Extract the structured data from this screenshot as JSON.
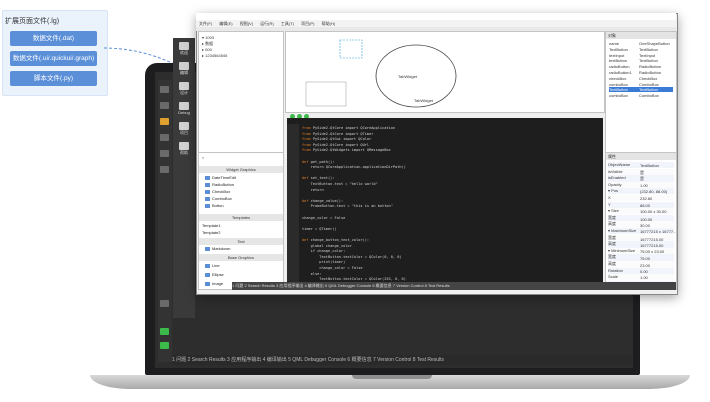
{
  "info_panel": {
    "title": "扩展页面文件(.lg)",
    "chips": [
      "数据文件(.dat)",
      "数据文件(.ui/.quickui/.graph)",
      "脚本文件(.py)"
    ]
  },
  "colors": {
    "accent": "#5b8fd8",
    "panel_bg": "#eaf2fc",
    "editor_bg": "#1e1e1e",
    "keyword": "#e67e22"
  },
  "app": {
    "menu": [
      "文件(F)",
      "编辑(E)",
      "视图(V)",
      "运行(R)",
      "工具(T)",
      "项目(P)",
      "帮助(H)"
    ],
    "left_tree": [
      "▾ 1003",
      "  ▸ 数据",
      "  ▸ 000",
      "  ▸ 1234564545"
    ],
    "canvas": {
      "ellipse_label": "TabWidget",
      "label_bottom": "TabWidget"
    },
    "widget_box": {
      "header": "Widget Graphics",
      "items": [
        "DateTimeEdit",
        "RadioButton",
        "CheckBox",
        "ComboBox",
        "Button"
      ],
      "templates_header": "Templates",
      "templates": [
        "Template1",
        "Template2"
      ],
      "text_header": "Text",
      "text_items": [
        "Markdown"
      ],
      "base_header": "Base Graphics",
      "base_items": [
        "Line",
        "Ellipse",
        "Image"
      ]
    },
    "code_lines": [
      {
        "kw": "from",
        "rest": " PySide2.QtCore import QCoreApplication"
      },
      {
        "kw": "from",
        "rest": " PySide2.QtCore import QTimer"
      },
      {
        "kw": "from",
        "rest": " PySide2.QtGui import QColor"
      },
      {
        "kw": "from",
        "rest": " PySide2.QtCore import QUrl"
      },
      {
        "kw": "from",
        "rest": " PySide2.QtWidgets import QMessageBox"
      },
      {
        "kw": "",
        "rest": ""
      },
      {
        "kw": "def",
        "rest": " get_path():"
      },
      {
        "kw": "",
        "rest": "    return QCoreApplication.applicationDirPath()"
      },
      {
        "kw": "",
        "rest": ""
      },
      {
        "kw": "def",
        "rest": " set_text():"
      },
      {
        "kw": "",
        "rest": "    TextButton.text = \"hello world\""
      },
      {
        "kw": "",
        "rest": "    return"
      },
      {
        "kw": "",
        "rest": ""
      },
      {
        "kw": "def",
        "rest": " change_value():"
      },
      {
        "kw": "",
        "rest": "    ProbeButton.text = \"this is an button\""
      },
      {
        "kw": "",
        "rest": ""
      },
      {
        "kw": "",
        "rest": "change_color = False"
      },
      {
        "kw": "",
        "rest": ""
      },
      {
        "kw": "",
        "rest": "timer = QTimer()"
      },
      {
        "kw": "",
        "rest": ""
      },
      {
        "kw": "def",
        "rest": " change_button_text_color():"
      },
      {
        "kw": "",
        "rest": "    global change_color"
      },
      {
        "kw": "",
        "rest": "    if change_color:"
      },
      {
        "kw": "",
        "rest": "        TextButton.textColor = QColor(0, 0, 0)"
      },
      {
        "kw": "",
        "rest": "        print(timer)"
      },
      {
        "kw": "",
        "rest": "        change_color = False"
      },
      {
        "kw": "",
        "rest": "    else:"
      },
      {
        "kw": "",
        "rest": "        TextButton.textColor = QColor(255, 0, 0)"
      }
    ],
    "objects_header": "对象",
    "objects": [
      {
        "name": "name",
        "cls": "OneShapeButton"
      },
      {
        "name": "TextButton",
        "cls": "TextButton"
      },
      {
        "name": "textInput",
        "cls": "TextInput"
      },
      {
        "name": "textButton",
        "cls": "TextButton"
      },
      {
        "name": "radioButton",
        "cls": "RadioButton"
      },
      {
        "name": "radioButton1",
        "cls": "RadioButton"
      },
      {
        "name": "checkBox",
        "cls": "CheckBox"
      },
      {
        "name": "comboBox",
        "cls": "ComboBox"
      },
      {
        "name": "TextButton",
        "cls": "TextButton"
      },
      {
        "name": "comboBox",
        "cls": "ComboBox"
      }
    ],
    "props_header": "属性",
    "props": [
      {
        "k": "ObjectName",
        "v": "TextButton"
      },
      {
        "k": "isVisible",
        "v": "是"
      },
      {
        "k": "isEnabled",
        "v": "是"
      },
      {
        "k": "Opacity",
        "v": "1.00"
      },
      {
        "k": "▾ Pos",
        "v": "(232.80, 88.00)"
      },
      {
        "k": "  X",
        "v": "232.80"
      },
      {
        "k": "  Y",
        "v": "88.00"
      },
      {
        "k": "▾ Size",
        "v": "100.00 x 30.00"
      },
      {
        "k": "  宽度",
        "v": "100.00"
      },
      {
        "k": "  高度",
        "v": "30.00"
      },
      {
        "k": "▾ MaximumSize",
        "v": "16777215 x 16777..."
      },
      {
        "k": "  宽度",
        "v": "16777215.00"
      },
      {
        "k": "  高度",
        "v": "16777215.00"
      },
      {
        "k": "▾ MinimumSize",
        "v": "75.00 x 23.00"
      },
      {
        "k": "  宽度",
        "v": "75.00"
      },
      {
        "k": "  高度",
        "v": "23.00"
      },
      {
        "k": "Rotation",
        "v": "0.00"
      },
      {
        "k": "Scale",
        "v": "1.00"
      },
      {
        "k": "ZValue",
        "v": "0.00"
      }
    ],
    "tabs": "1 问题   2 Search Results   3 应用程序输出   4 编译输出   5 QML Debugger Console   6 概要信息   7 Version Control   8 Test Results"
  },
  "laptop": {
    "bottom_tabs": "1 问题   2 Search Results   3 应用程序输出   4 编译输出   5 QML Debugger Console   6 概要信息   7 Version Control   8 Test Results",
    "sidebar_labels": [
      "欢迎",
      "编辑",
      "设计",
      "Debug",
      "项目",
      "帮助"
    ]
  }
}
